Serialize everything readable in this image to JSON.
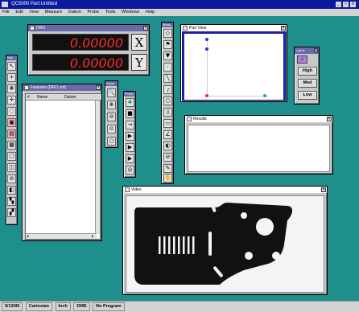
{
  "app": {
    "title": "QC5000 Part:Untitled"
  },
  "title_controls": [
    "_",
    "□",
    "X"
  ],
  "menu": [
    "File",
    "Edit",
    "View",
    "Measure",
    "Datum",
    "Probe",
    "Tools",
    "Windows",
    "Help"
  ],
  "dro": {
    "title": "DRO",
    "x_value": "0.00000",
    "y_value": "0.00000",
    "x_axis": "X",
    "y_axis": "Y"
  },
  "features": {
    "title": "Features (DRO unt)",
    "col_num": "#",
    "col_name": "Name",
    "col_datum": "Datum"
  },
  "toolbar_labels": {
    "left": "Nav",
    "zoom": "Zoom",
    "probes": "Probe",
    "measure": "Meas",
    "lights": "Lights"
  },
  "partview": {
    "title": "Part View"
  },
  "results": {
    "title": "Results"
  },
  "video": {
    "title": "Video"
  },
  "lights": {
    "high": "High",
    "med": "Med",
    "low": "Low"
  },
  "status": {
    "date": "5/13/05",
    "coords": "Cartesian",
    "units": "Inch",
    "format": "DMS",
    "program": "No Program"
  },
  "colors": {
    "desktop": "#1f8f8b",
    "titlebar": "#0a1aa0",
    "dro_digits": "#ff2a2a"
  }
}
